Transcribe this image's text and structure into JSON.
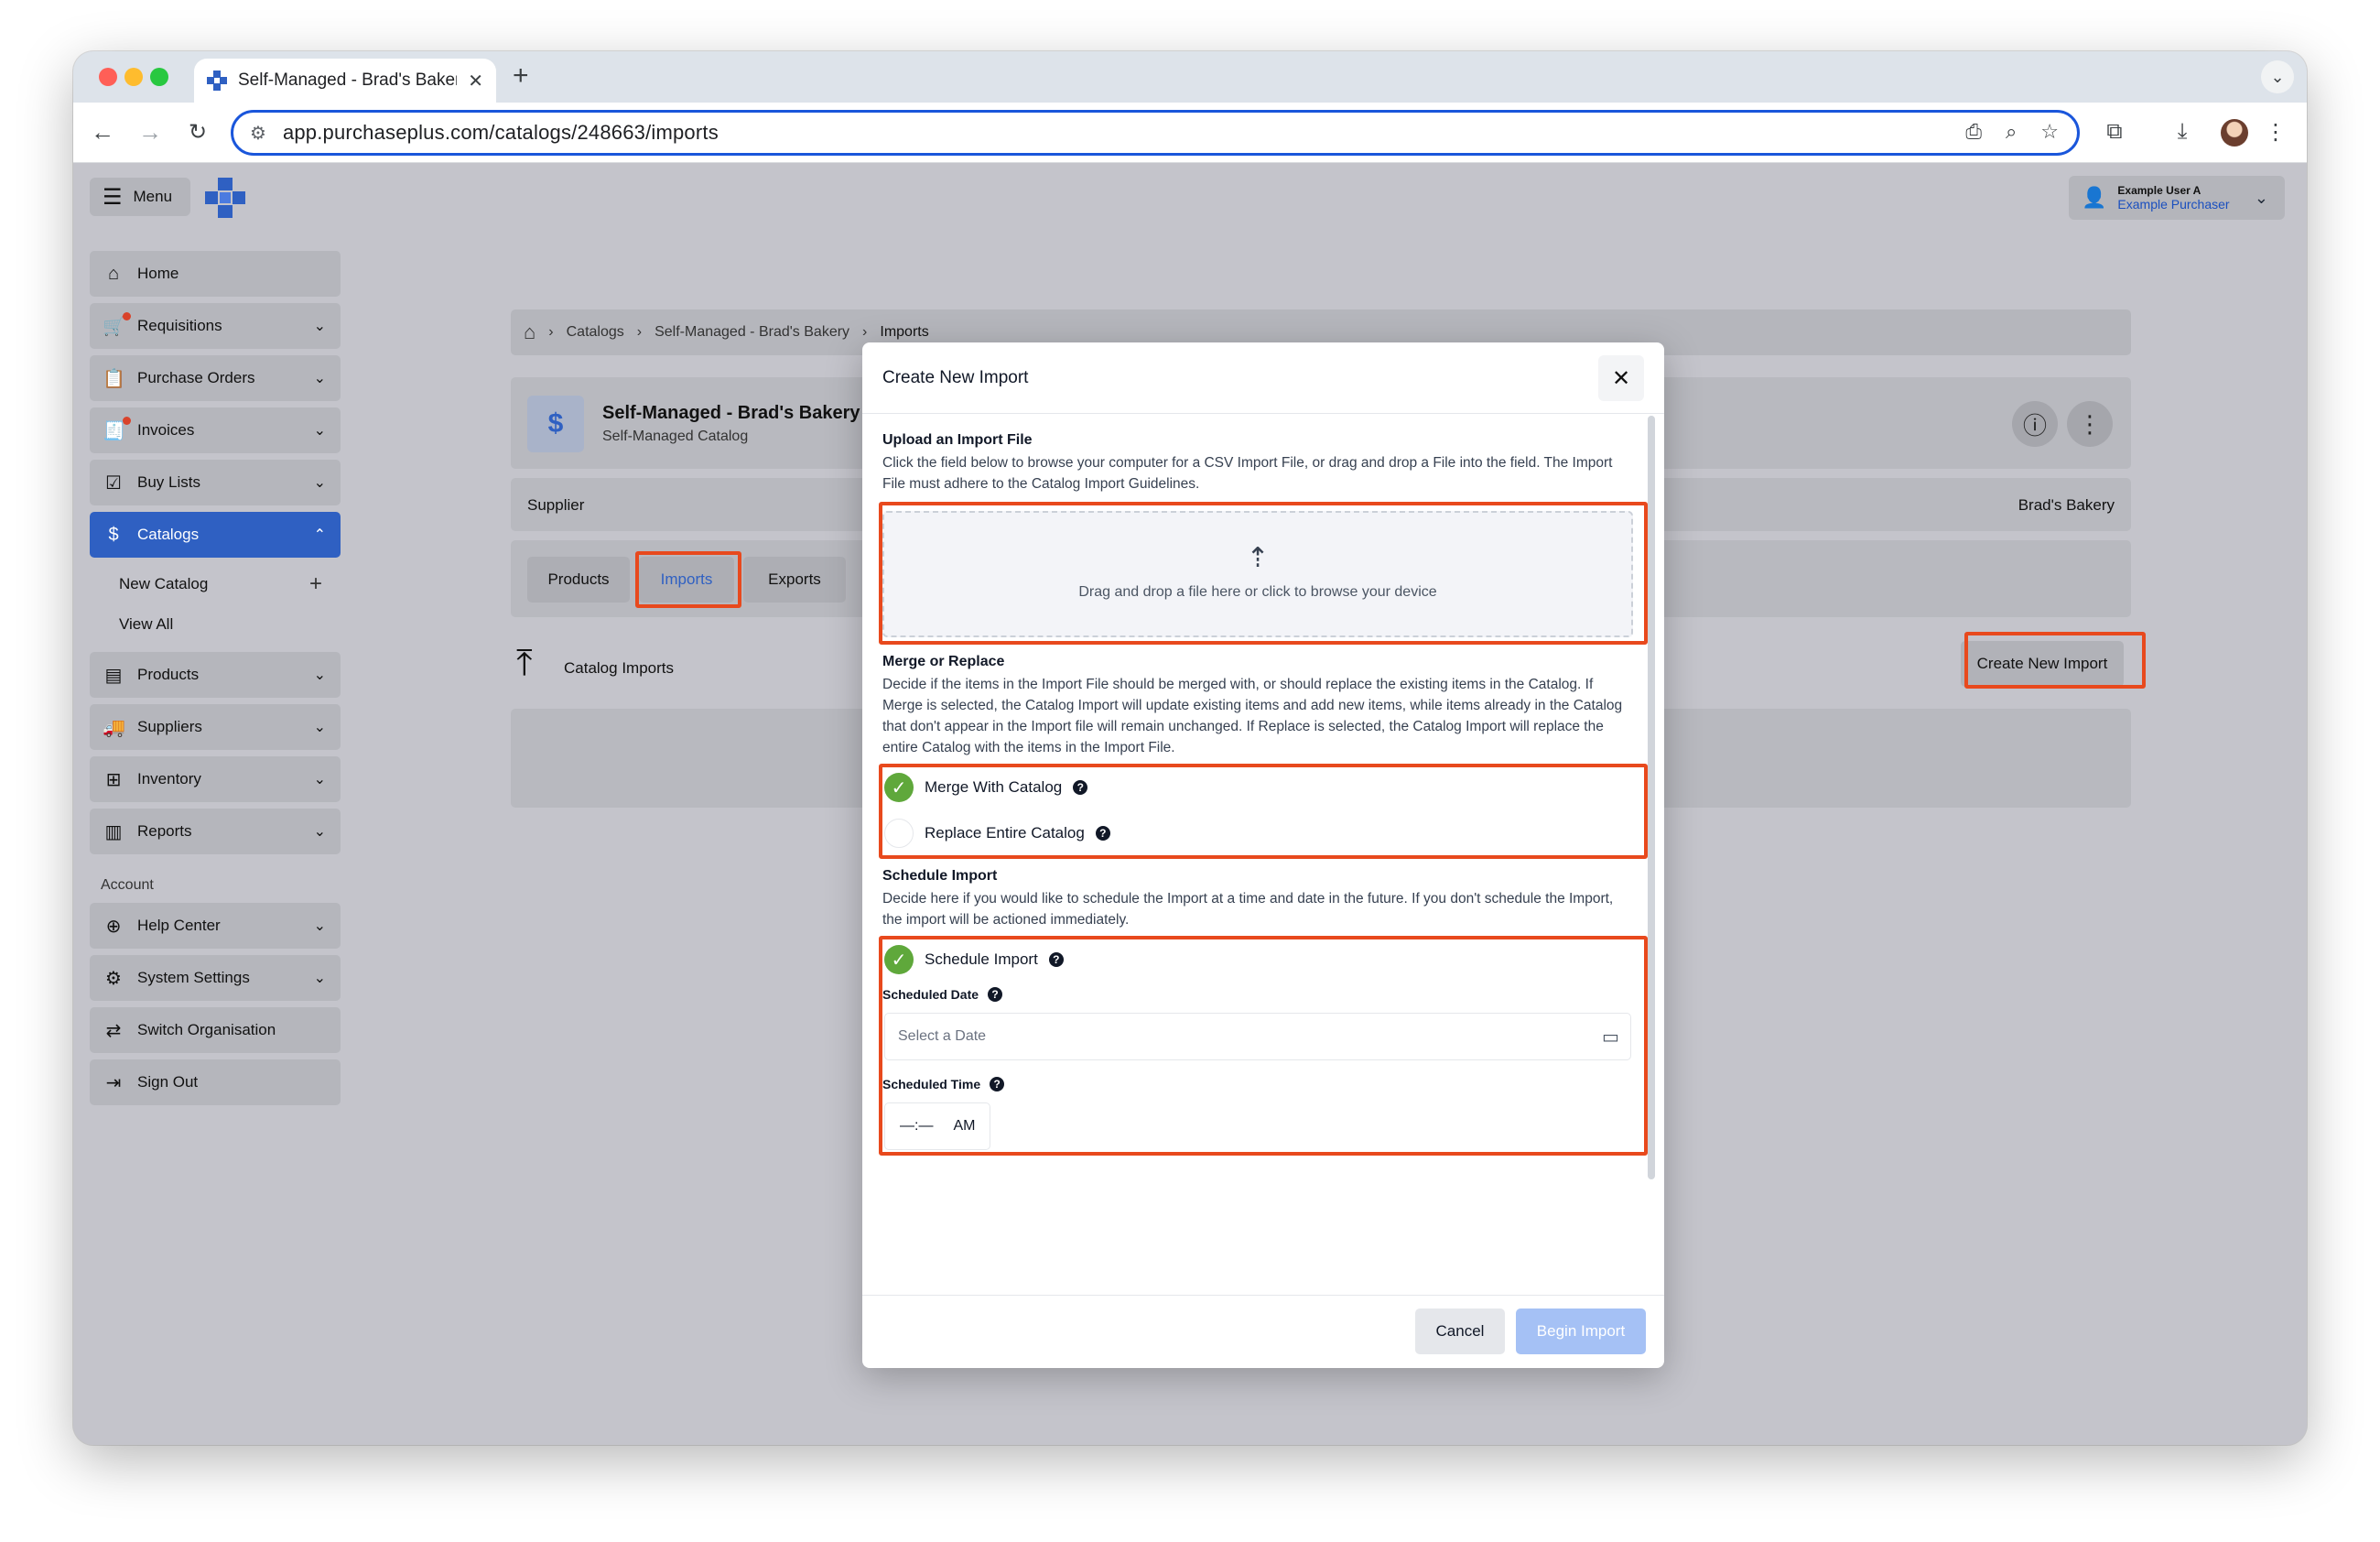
{
  "browser": {
    "tab_title": "Self-Managed - Brad's Bakery",
    "url": "app.purchaseplus.com/catalogs/248663/imports"
  },
  "header": {
    "menu_label": "Menu",
    "user_name": "Example User A",
    "user_role": "Example Purchaser"
  },
  "sidebar": {
    "items": [
      {
        "label": "Home"
      },
      {
        "label": "Requisitions"
      },
      {
        "label": "Purchase Orders"
      },
      {
        "label": "Invoices"
      },
      {
        "label": "Buy Lists"
      },
      {
        "label": "Catalogs"
      },
      {
        "label": "Products"
      },
      {
        "label": "Suppliers"
      },
      {
        "label": "Inventory"
      },
      {
        "label": "Reports"
      }
    ],
    "catalog_sub": {
      "new_catalog": "New Catalog",
      "view_all": "View All"
    },
    "account_label": "Account",
    "account_items": [
      {
        "label": "Help Center"
      },
      {
        "label": "System Settings"
      },
      {
        "label": "Switch Organisation"
      },
      {
        "label": "Sign Out"
      }
    ]
  },
  "breadcrumb": {
    "items": [
      "Catalogs",
      "Self-Managed - Brad's Bakery",
      "Imports"
    ]
  },
  "catalog": {
    "title": "Self-Managed - Brad's Bakery",
    "subtitle": "Self-Managed Catalog",
    "supplier_label": "Supplier",
    "supplier_value": "Brad's Bakery"
  },
  "tabs": [
    "Products",
    "Imports",
    "Exports"
  ],
  "imports": {
    "title": "Catalog Imports",
    "create_button": "Create New Import"
  },
  "modal": {
    "title": "Create New Import",
    "upload": {
      "title": "Upload an Import File",
      "desc": "Click the field below to browse your computer for a CSV Import File, or drag and drop a File into the field. The Import File must adhere to the Catalog Import Guidelines.",
      "dropzone_text": "Drag and drop a file here or click to browse your device"
    },
    "merge": {
      "title": "Merge or Replace",
      "desc": "Decide if the items in the Import File should be merged with, or should replace the existing items in the Catalog. If Merge is selected, the Catalog Import will update existing items and add new items, while items already in the Catalog that don't appear in the Import file will remain unchanged. If Replace is selected, the Catalog Import will replace the entire Catalog with the items in the Import File.",
      "option_merge": "Merge With Catalog",
      "option_replace": "Replace Entire Catalog"
    },
    "schedule": {
      "title": "Schedule Import",
      "desc": "Decide here if you would like to schedule the Import at a time and date in the future. If you don't schedule the Import, the import will be actioned immediately.",
      "toggle_label": "Schedule Import",
      "date_label": "Scheduled Date",
      "date_placeholder": "Select a Date",
      "time_label": "Scheduled Time",
      "time_value": "—:—",
      "time_period": "AM"
    },
    "cancel_label": "Cancel",
    "begin_label": "Begin Import"
  },
  "colors": {
    "highlight": "#e8491d",
    "accent": "#2f60c2",
    "success": "#5fa83b",
    "primary_disabled": "#a5c1f5"
  }
}
